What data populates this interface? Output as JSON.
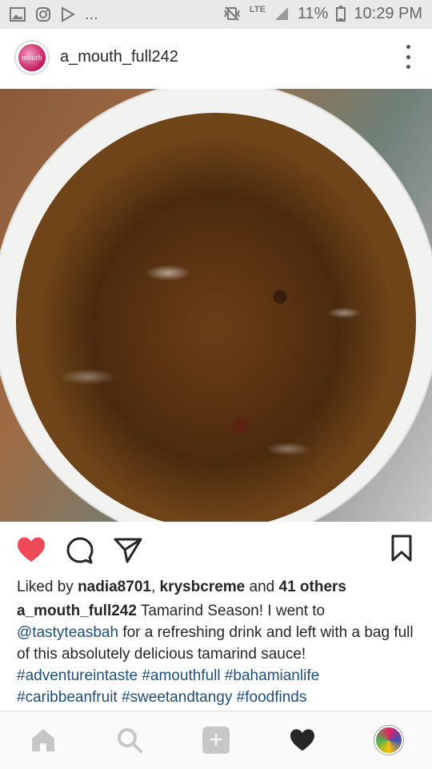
{
  "status_bar": {
    "battery": "11%",
    "time": "10:29 PM",
    "network": "LTE",
    "overflow": "..."
  },
  "post": {
    "username": "a_mouth_full242",
    "likes": {
      "prefix": "Liked by",
      "user1": "nadia8701",
      "sep": ",",
      "user2": "krysbcreme",
      "and": "and",
      "others": "41 others"
    },
    "caption": {
      "author": "a_mouth_full242",
      "text1": "Tamarind Season! I went to",
      "mention": "@tastyteasbah",
      "text2": "for a refreshing drink and left with a bag full of this absolutely delicious tamarind sauce!",
      "hashtags": [
        "#adventureintaste",
        "#amouthfull",
        "#bahamianlife",
        "#caribbeanfruit",
        "#sweetandtangy",
        "#foodfinds"
      ]
    }
  },
  "colors": {
    "like_red": "#ed4956",
    "link_blue": "#1f4e79"
  },
  "icons": [
    "home-icon",
    "search-icon",
    "add-post-icon",
    "activity-heart-icon",
    "profile-icon",
    "heart-icon",
    "comment-icon",
    "share-icon",
    "bookmark-icon"
  ]
}
